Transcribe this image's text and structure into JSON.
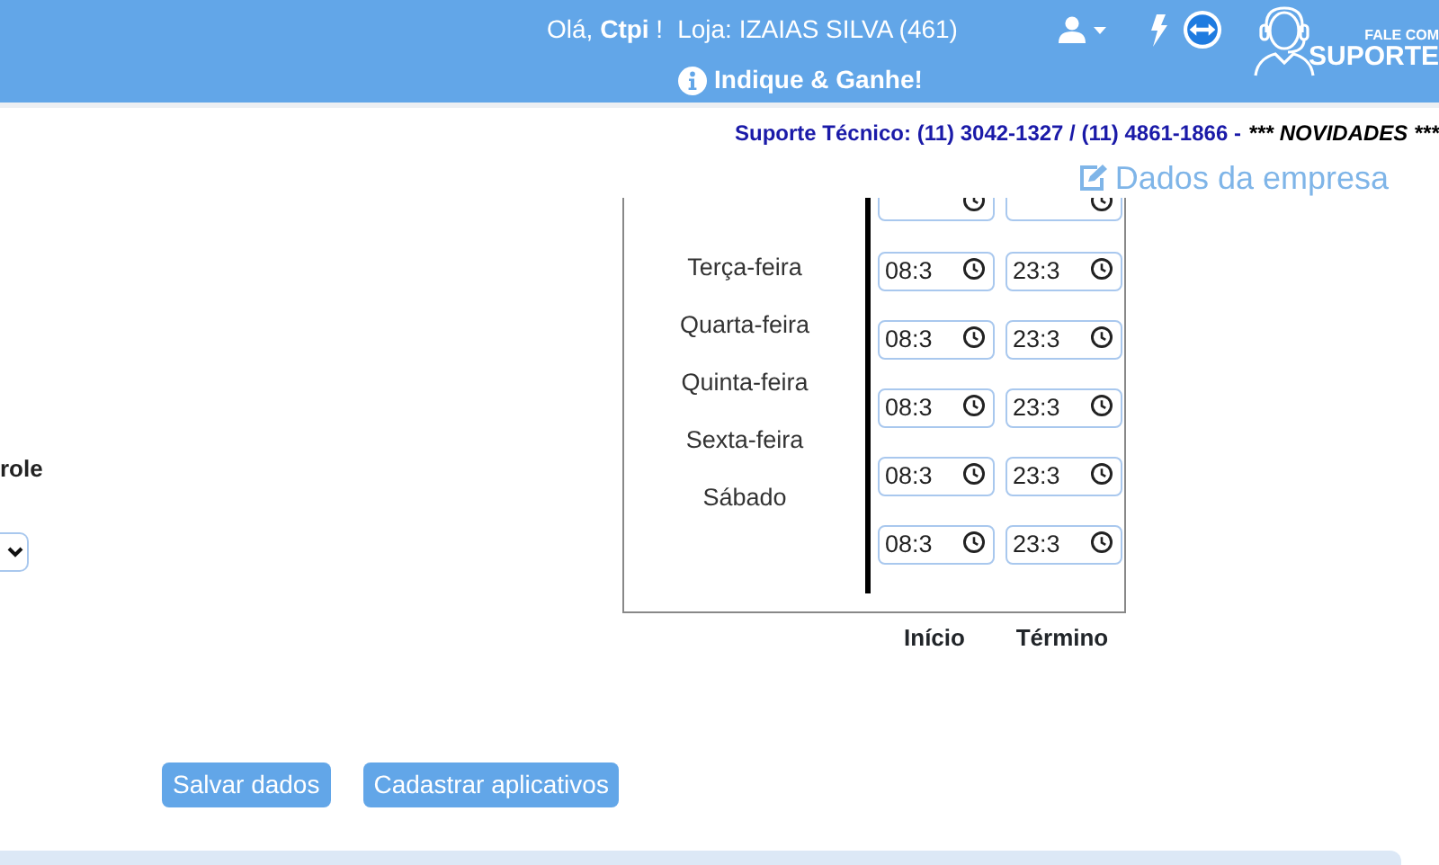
{
  "header": {
    "greeting": "Olá, **Ctpi** !",
    "store": "Loja: IZAIAS SILVA (461)",
    "referral": "Indique & Ganhe!",
    "support_badge": {
      "line_1": "FALE COM",
      "line_2": "SUPORTE"
    }
  },
  "notice": {
    "contact": "Suporte Técnico: (11) 3042-1327 / (11) 4861-1866 -",
    "news": "*** NOVIDADES ***"
  },
  "company_link": "Dados da empresa",
  "left_field": {
    "label": "role"
  },
  "schedule": {
    "days": [
      "Terça-feira",
      "Quarta-feira",
      "Quinta-feira",
      "Sexta-feira",
      "Sábado"
    ],
    "cut_row_above": true,
    "times": [
      {
        "start": "08:3",
        "end": "23:3"
      },
      {
        "start": "08:3",
        "end": "23:3"
      },
      {
        "start": "08:3",
        "end": "23:3"
      },
      {
        "start": "08:3",
        "end": "23:3"
      },
      {
        "start": "08:3",
        "end": "23:3"
      }
    ],
    "columns": [
      "Início",
      "Término"
    ]
  },
  "buttons": [
    "Salvar dados",
    "Cadastrar aplicativos"
  ]
}
